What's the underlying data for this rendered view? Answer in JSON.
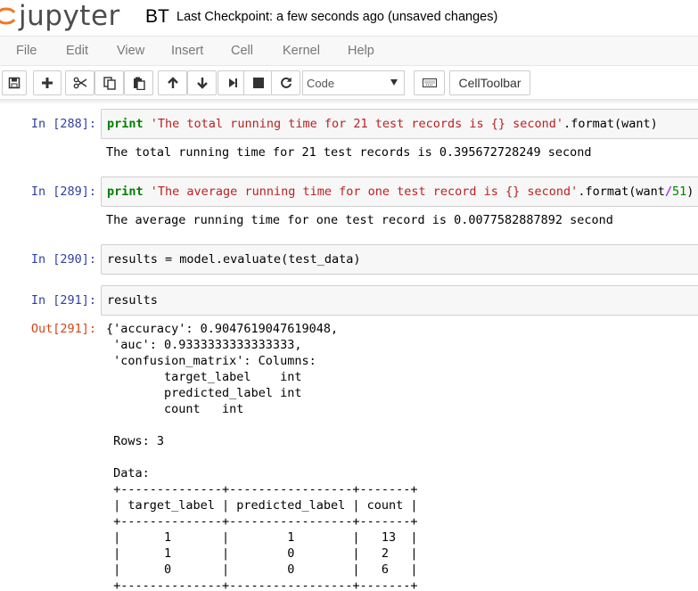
{
  "header": {
    "logo_text": "jupyter",
    "notebook_name": "BT",
    "checkpoint": "Last Checkpoint: a few seconds ago (unsaved changes)"
  },
  "menu": [
    "File",
    "Edit",
    "View",
    "Insert",
    "Cell",
    "Kernel",
    "Help"
  ],
  "toolbar": {
    "cell_type": "Code",
    "celltoolbar_label": "CellToolbar",
    "icons": [
      "save-icon",
      "plus-icon",
      "scissors-icon",
      "copy-icon",
      "paste-icon",
      "arrow-up-icon",
      "arrow-down-icon",
      "step-forward-icon",
      "stop-icon",
      "refresh-icon",
      "keyboard-icon"
    ]
  },
  "cells": [
    {
      "prompt": "In [288]:",
      "code": {
        "kw": "print",
        "str": "'The total running time for 21 test records is {} second'",
        "dot": ".",
        "fn": "format",
        "args": "(want)"
      },
      "output": "The total running time for 21 test records is 0.395672728249 second"
    },
    {
      "prompt": "In [289]:",
      "code": {
        "kw": "print",
        "str": "'The average running time for one test record is {} second'",
        "dot": ".",
        "fn": "format",
        "args_open": "(want",
        "op": "/",
        "num": "51",
        "args_close": ")"
      },
      "output": "The average running time for one test record is 0.0077582887892 second"
    },
    {
      "prompt": "In [290]:",
      "code": {
        "text": "results = model.evaluate(test_data)"
      }
    },
    {
      "prompt": "In [291]:",
      "code": {
        "text": "results"
      },
      "out_prompt": "Out[291]:",
      "output": "{'accuracy': 0.9047619047619048,\n 'auc': 0.9333333333333333,\n 'confusion_matrix': Columns:\n \ttarget_label\tint\n \tpredicted_label\tint\n \tcount\tint\n \n Rows: 3\n \n Data:\n +--------------+-----------------+-------+\n | target_label | predicted_label | count |\n +--------------+-----------------+-------+\n |      1       |        1        |   13  |\n |      1       |        0        |   2   |\n |      0       |        0        |   6   |\n +--------------+-----------------+-------+"
    }
  ]
}
